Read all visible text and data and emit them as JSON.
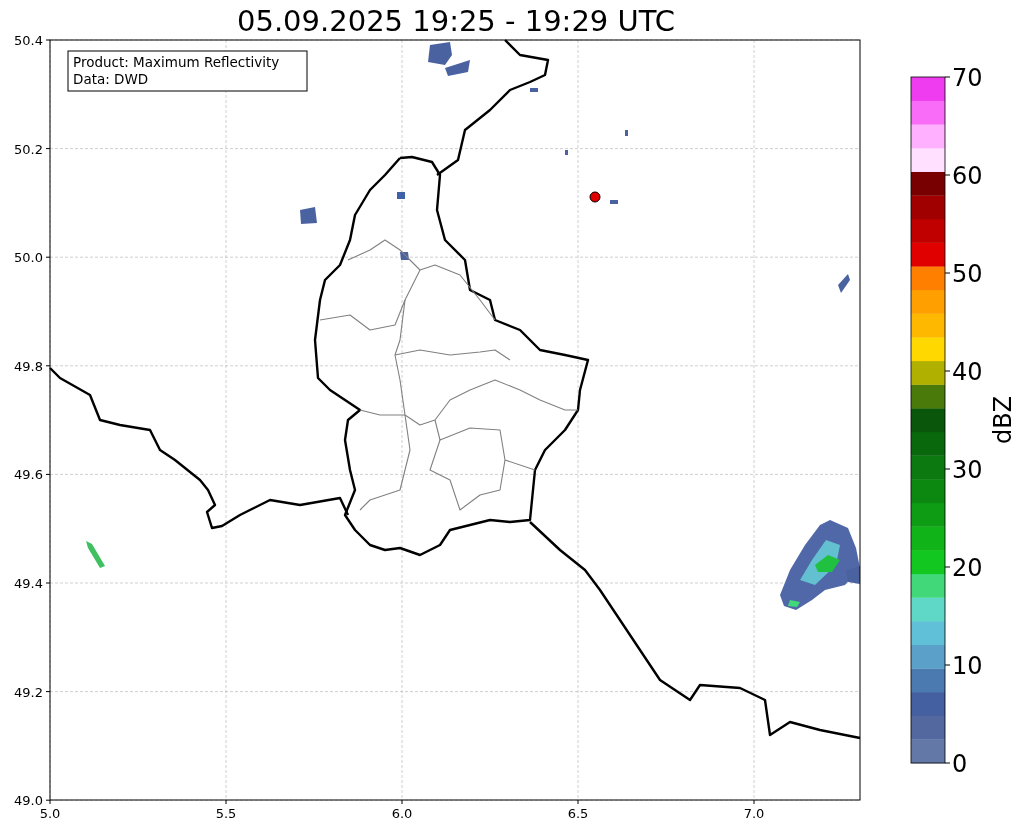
{
  "title": "05.09.2025 19:25 - 19:29 UTC",
  "info_box": {
    "lines": [
      "Product: Maximum Reflectivity",
      "Data: DWD"
    ]
  },
  "map": {
    "x_ticks": [
      "5.0",
      "5.5",
      "6.0",
      "6.5",
      "7.0"
    ],
    "y_ticks": [
      "50.4",
      "50.2",
      "50.0",
      "49.8",
      "49.6",
      "49.4",
      "49.2",
      "49.0"
    ]
  },
  "colorbar": {
    "label": "dBZ",
    "ticks": [
      "70",
      "60",
      "50",
      "40",
      "30",
      "20",
      "10",
      "0"
    ],
    "bands": [
      {
        "color": "#6478a8"
      },
      {
        "color": "#5468a0"
      },
      {
        "color": "#4460a0"
      },
      {
        "color": "#4a7ab0"
      },
      {
        "color": "#5aa0c8"
      },
      {
        "color": "#60c0d8"
      },
      {
        "color": "#60d8c8"
      },
      {
        "color": "#40d878"
      },
      {
        "color": "#12c820"
      },
      {
        "color": "#10b418"
      },
      {
        "color": "#0e9c14"
      },
      {
        "color": "#0c8810"
      },
      {
        "color": "#0c7810"
      },
      {
        "color": "#0a680c"
      },
      {
        "color": "#0a560a"
      },
      {
        "color": "#4a7a0a"
      },
      {
        "color": "#b0b000"
      },
      {
        "color": "#ffd800"
      },
      {
        "color": "#ffb800"
      },
      {
        "color": "#ffa000"
      },
      {
        "color": "#ff8000"
      },
      {
        "color": "#e00000"
      },
      {
        "color": "#c00000"
      },
      {
        "color": "#a00000"
      },
      {
        "color": "#780000"
      },
      {
        "color": "#ffe0ff"
      },
      {
        "color": "#ffb0ff"
      },
      {
        "color": "#f86cf8"
      },
      {
        "color": "#f03cf0"
      }
    ]
  }
}
